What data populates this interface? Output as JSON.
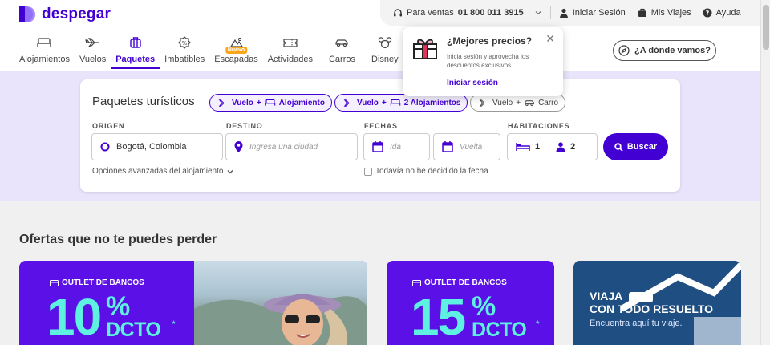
{
  "brand": {
    "name": "despegar",
    "accent": "#4300d2"
  },
  "topbar": {
    "sales_label": "Para ventas",
    "sales_phone": "01 800 011 3915",
    "login": "Iniciar Sesión",
    "my_trips": "Mis Viajes",
    "help": "Ayuda"
  },
  "nav": {
    "tabs": [
      {
        "label": "Alojamientos",
        "icon": "bed-icon"
      },
      {
        "label": "Vuelos",
        "icon": "plane-icon"
      },
      {
        "label": "Paquetes",
        "icon": "suitcase-icon",
        "active": true
      },
      {
        "label": "Imbatibles",
        "icon": "discount-badge-icon"
      },
      {
        "label": "Escapadas",
        "icon": "getaway-icon",
        "badge": "Nuevo"
      },
      {
        "label": "Actividades",
        "icon": "ticket-icon"
      },
      {
        "label": "Carros",
        "icon": "car-icon"
      },
      {
        "label": "Disney",
        "icon": "disney-icon"
      }
    ],
    "destination_button": "¿A dónde vamos?"
  },
  "popup": {
    "title": "¿Mejores precios?",
    "description": "Inicia sesión y aprovecha los descuentos exclusivos.",
    "link": "Iniciar sesión"
  },
  "search": {
    "title": "Paquetes turísticos",
    "chips": [
      {
        "a": "Vuelo",
        "b": "Alojamiento",
        "selected": true
      },
      {
        "a": "Vuelo",
        "b": "2 Alojamientos",
        "selected": true
      },
      {
        "a": "Vuelo",
        "b": "Carro",
        "selected": false
      }
    ],
    "origin_label": "ORIGEN",
    "origin_value": "Bogotá, Colombia",
    "destination_label": "DESTINO",
    "destination_placeholder": "Ingresa una ciudad",
    "dates_label": "FECHAS",
    "depart_placeholder": "Ida",
    "return_placeholder": "Vuelta",
    "rooms_label": "HABITACIONES",
    "rooms_count": "1",
    "guests_count": "2",
    "search_button": "Buscar",
    "advanced_options": "Opciones avanzadas del alojamiento",
    "undecided_dates": "Todavía no he decidido la fecha"
  },
  "offers": {
    "title": "Ofertas que no te puedes perder",
    "cards": [
      {
        "label": "OUTLET DE BANCOS",
        "number": "10",
        "pct": "%",
        "dcto": "DCTO",
        "star": "*"
      },
      {
        "label": "OUTLET DE BANCOS",
        "number": "15",
        "pct": "%",
        "dcto": "DCTO",
        "star": "*"
      },
      {
        "line1": "VIAJA",
        "line2": "CON TODO RESUELTO",
        "sub": "Encuentra aquí tu viaje."
      }
    ]
  }
}
